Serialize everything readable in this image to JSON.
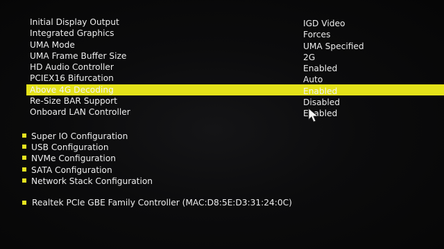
{
  "settings": [
    {
      "label": "Initial Display Output",
      "value": "IGD Video"
    },
    {
      "label": "Integrated Graphics",
      "value": "Forces"
    },
    {
      "label": "UMA Mode",
      "value": "UMA Specified"
    },
    {
      "label": "UMA Frame Buffer Size",
      "value": "2G"
    },
    {
      "label": "HD Audio Controller",
      "value": "Enabled"
    },
    {
      "label": "PCIEX16 Bifurcation",
      "value": "Auto"
    },
    {
      "label": "Above 4G Decoding",
      "value": "Enabled"
    },
    {
      "label": "Re-Size BAR Support",
      "value": "Disabled"
    },
    {
      "label": "Onboard LAN Controller",
      "value": "Enabled"
    }
  ],
  "submenus": [
    {
      "label": "Super IO Configuration"
    },
    {
      "label": "USB Configuration"
    },
    {
      "label": "NVMe Configuration"
    },
    {
      "label": "SATA Configuration"
    },
    {
      "label": "Network Stack Configuration"
    }
  ],
  "nic": {
    "label": "Realtek PCIe GBE Family Controller (MAC:D8:5E:D3:31:24:0C)"
  },
  "colors": {
    "highlight": "#e4e21a",
    "bullet": "#e8e620",
    "text": "#ececec",
    "background": "#0b0b0c"
  },
  "icons": {
    "cursor": "mouse-pointer-icon",
    "bullet": "bullet-icon"
  }
}
